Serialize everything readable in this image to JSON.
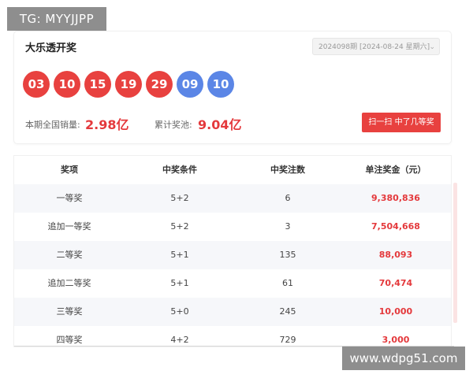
{
  "overlay": {
    "tg_label": "TG: MYYJJPP",
    "watermark": "www.wdpg51.com"
  },
  "header": {
    "title": "大乐透开奖",
    "issue_select": "2024098期 [2024-08-24 星期六]"
  },
  "balls": {
    "red": [
      "03",
      "10",
      "15",
      "19",
      "29"
    ],
    "blue": [
      "09",
      "10"
    ],
    "colors": {
      "red": "#e8413f",
      "blue": "#5b86e6"
    }
  },
  "stats": {
    "sales_label": "本期全国销量:",
    "sales_value": "2.98亿",
    "pool_label": "累计奖池:",
    "pool_value": "9.04亿",
    "scan_button": "扫一扫 中了几等奖"
  },
  "table": {
    "headers": [
      "奖项",
      "中奖条件",
      "中奖注数",
      "单注奖金（元）"
    ],
    "rows": [
      {
        "prize": "一等奖",
        "condition": "5+2",
        "count": "6",
        "amount": "9,380,836"
      },
      {
        "prize": "追加一等奖",
        "condition": "5+2",
        "count": "3",
        "amount": "7,504,668"
      },
      {
        "prize": "二等奖",
        "condition": "5+1",
        "count": "135",
        "amount": "88,093"
      },
      {
        "prize": "追加二等奖",
        "condition": "5+1",
        "count": "61",
        "amount": "70,474"
      },
      {
        "prize": "三等奖",
        "condition": "5+0",
        "count": "245",
        "amount": "10,000"
      },
      {
        "prize": "四等奖",
        "condition": "4+2",
        "count": "729",
        "amount": "3,000"
      }
    ]
  },
  "accent_color": "#e4393c"
}
